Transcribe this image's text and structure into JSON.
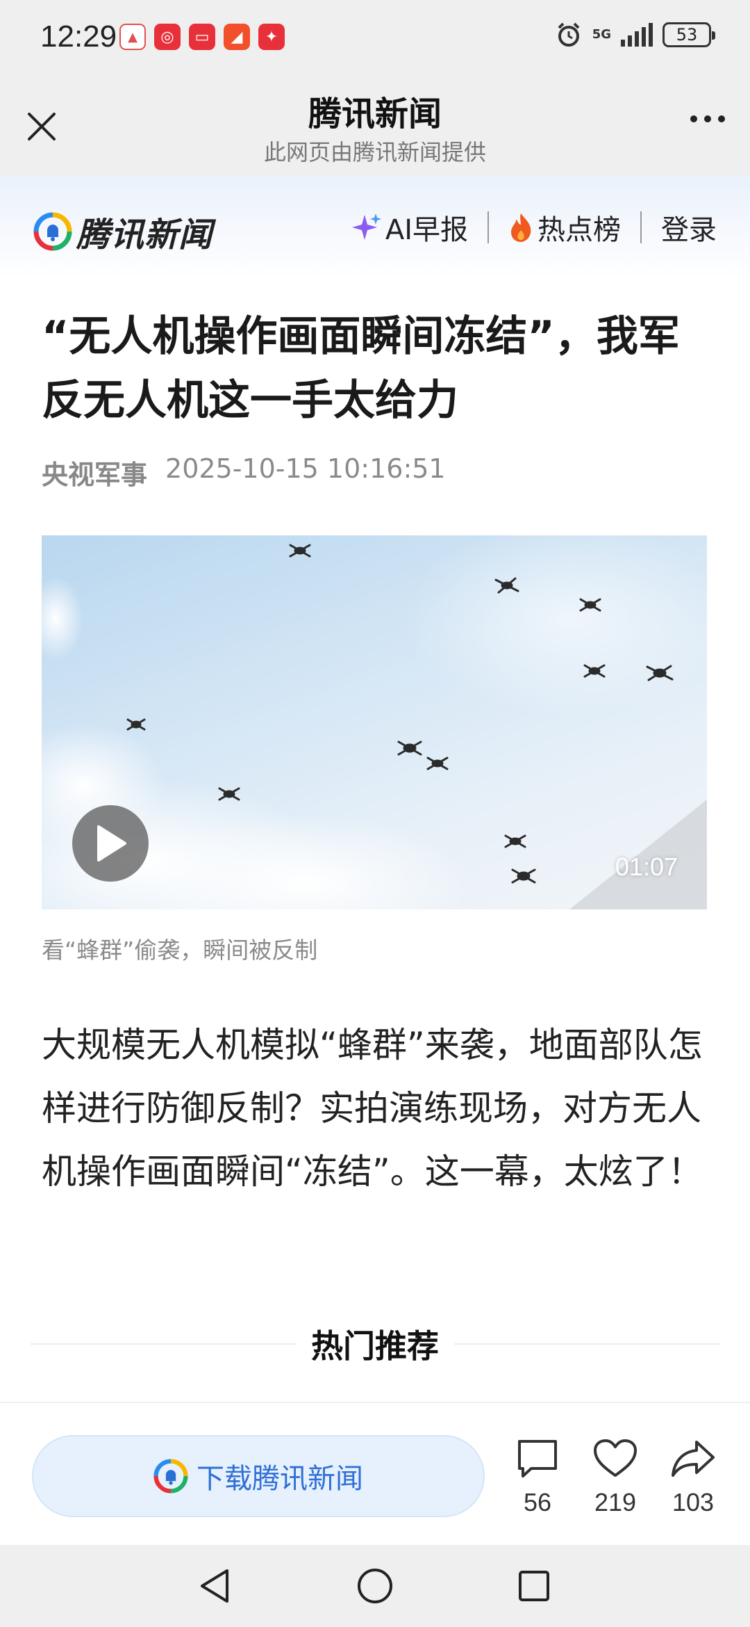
{
  "status_bar": {
    "time": "12:29",
    "network": "5G",
    "battery": "53"
  },
  "title_bar": {
    "title": "腾讯新闻",
    "subtitle": "此网页由腾讯新闻提供"
  },
  "site_header": {
    "logo_text": "腾讯新闻",
    "nav": {
      "ai_brief": "AI早报",
      "hot_list": "热点榜",
      "login": "登录"
    }
  },
  "article": {
    "headline": "“无人机操作画面瞬间冻结”，我军反无人机这一手太给力",
    "source": "央视军事",
    "datetime": "2025-10-15 10:16:51",
    "video": {
      "duration": "01:07",
      "caption": "看“蜂群”偷袭，瞬间被反制"
    },
    "body": "大规模无人机模拟“蜂群”来袭，地面部队怎样进行防御反制？实拍演练现场，对方无人机操作画面瞬间“冻结”。这一幕，太炫了！"
  },
  "hot_section": {
    "title": "热门推荐"
  },
  "action_bar": {
    "download_label": "下载腾讯新闻",
    "comments": "56",
    "likes": "219",
    "shares": "103"
  },
  "colors": {
    "accent_blue": "#2f6fd6",
    "download_bg": "#e6f1fd",
    "chrome_gray": "#efefef"
  }
}
